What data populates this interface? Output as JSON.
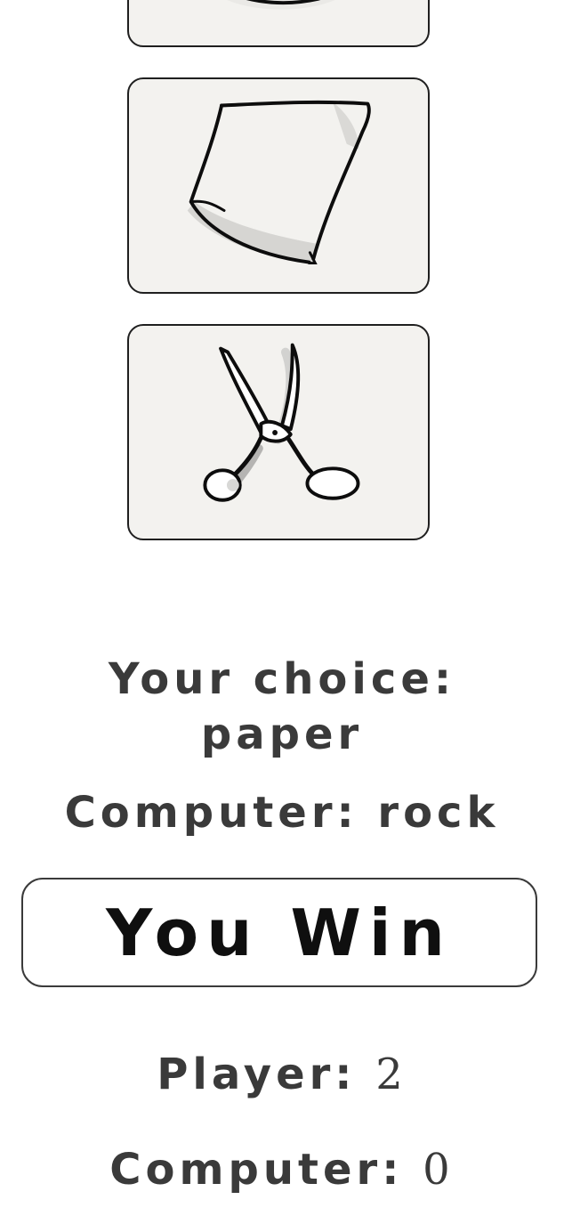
{
  "choices": [
    {
      "id": "rock",
      "icon": "rock-drawing-icon"
    },
    {
      "id": "paper",
      "icon": "paper-drawing-icon"
    },
    {
      "id": "scissors",
      "icon": "scissors-drawing-icon"
    }
  ],
  "status": {
    "your_choice_label": "Your choice:",
    "your_choice_value": "paper",
    "computer_choice_label": "Computer:",
    "computer_choice_value": "rock"
  },
  "result": {
    "text": "You Win"
  },
  "score": {
    "player_label": "Player:",
    "player_value": "2",
    "computer_label": "Computer:",
    "computer_value": "0"
  },
  "colors": {
    "card_background": "#f3f2ef",
    "card_border": "#1f1f1f",
    "text": "#3a3a3a",
    "result_text": "#0f0f0f"
  }
}
